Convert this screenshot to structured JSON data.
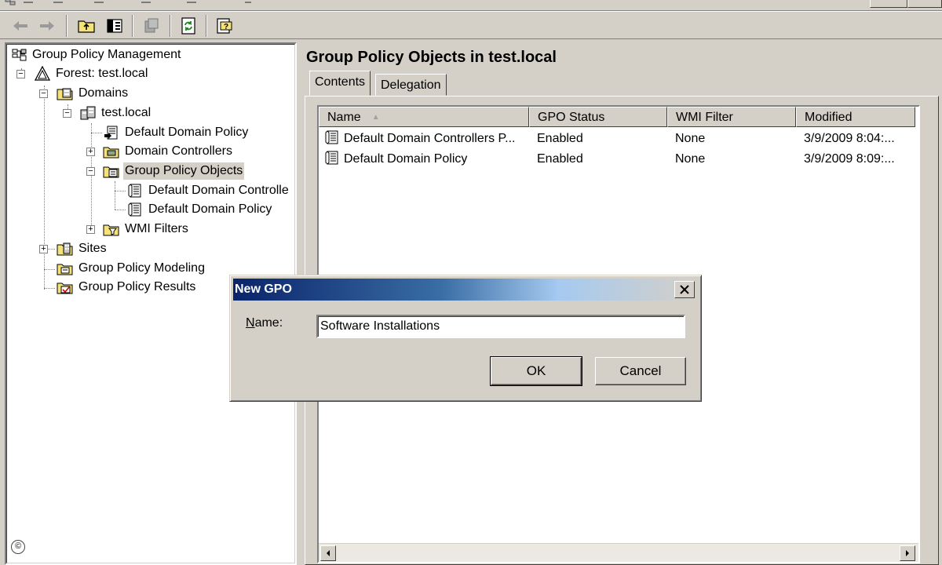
{
  "tree": {
    "root": "Group Policy Management",
    "forest": "Forest: test.local",
    "domains": "Domains",
    "domain": "test.local",
    "default_domain_policy_link": "Default Domain Policy",
    "domain_controllers": "Domain Controllers",
    "group_policy_objects": "Group Policy Objects",
    "gpo_children": [
      "Default Domain Controlle",
      "Default Domain Policy"
    ],
    "wmi_filters": "WMI Filters",
    "sites": "Sites",
    "modeling": "Group Policy Modeling",
    "results": "Group Policy Results"
  },
  "main": {
    "title": "Group Policy Objects in test.local",
    "tabs": [
      {
        "label": "Contents",
        "active": true
      },
      {
        "label": "Delegation",
        "active": false
      }
    ],
    "columns": [
      "Name",
      "GPO Status",
      "WMI Filter",
      "Modified"
    ],
    "rows": [
      {
        "name": "Default Domain Controllers P...",
        "status": "Enabled",
        "wmi": "None",
        "modified": "3/9/2009 8:04:..."
      },
      {
        "name": "Default Domain Policy",
        "status": "Enabled",
        "wmi": "None",
        "modified": "3/9/2009 8:09:..."
      }
    ]
  },
  "dialog": {
    "title": "New GPO",
    "name_label_accel": "N",
    "name_label_rest": "ame:",
    "name_value": "Software Installations",
    "ok_label": "OK",
    "cancel_label": "Cancel"
  },
  "footer": {
    "copyright_symbol": "©"
  },
  "colors": {
    "titlebar_start": "#0a246a",
    "titlebar_end": "#a6caf0",
    "face": "#d4d0c8",
    "selection": "#d4d0c8"
  },
  "icons": {
    "toolbar": [
      "back-arrow-icon",
      "forward-arrow-icon",
      "up-folder-icon",
      "show-hide-tree-icon",
      "delete-icon",
      "refresh-icon",
      "help-icon"
    ],
    "tree": [
      "gpm-icon",
      "forest-icon",
      "domains-icon",
      "domain-icon",
      "gpo-link-icon",
      "ou-icon",
      "gpo-container-icon",
      "gpo-icon",
      "wmi-filter-icon",
      "sites-icon",
      "modeling-icon",
      "results-icon"
    ]
  }
}
